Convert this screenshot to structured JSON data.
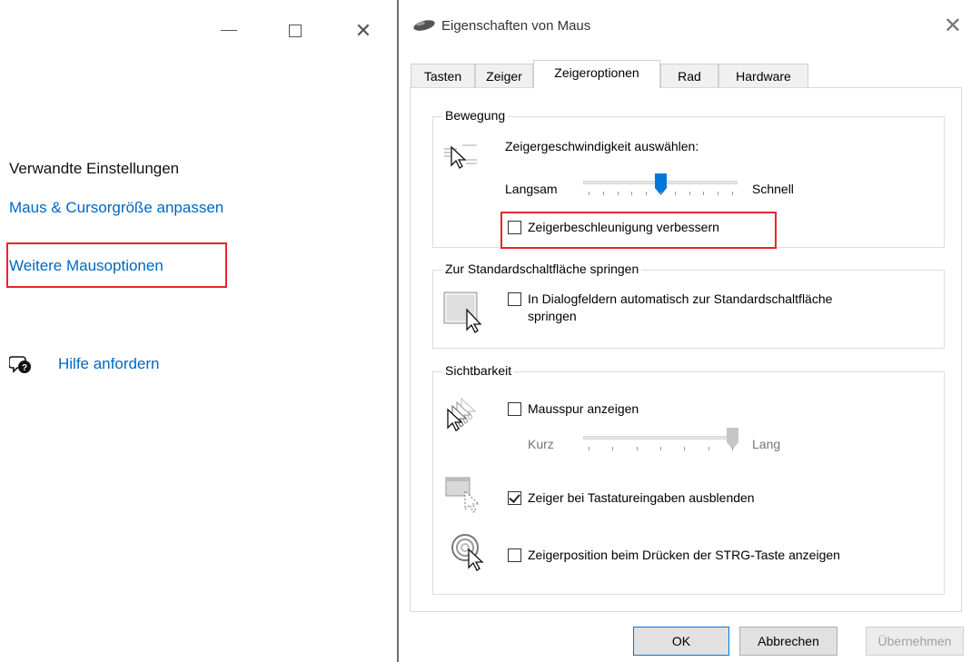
{
  "settings": {
    "related_title": "Verwandte Einstellungen",
    "link_cursor": "Maus & Cursorgröße anpassen",
    "link_more": "Weitere Mausoptionen",
    "help": "Hilfe anfordern",
    "window_controls": [
      "minimize-icon",
      "maximize-icon",
      "close-icon"
    ]
  },
  "dialog": {
    "title": "Eigenschaften von Maus",
    "tabs": [
      "Tasten",
      "Zeiger",
      "Zeigeroptionen",
      "Rad",
      "Hardware"
    ],
    "active_tab": "Zeigeroptionen",
    "motion": {
      "label": "Bewegung",
      "speed_label": "Zeigergeschwindigkeit auswählen:",
      "slow": "Langsam",
      "fast": "Schnell",
      "speed_value": 0.5,
      "precision_label": "Zeigerbeschleunigung verbessern",
      "precision_checked": false
    },
    "snap": {
      "label": "Zur Standardschaltfläche springen",
      "option_label_line1": "In Dialogfeldern automatisch zur Standardschaltfläche",
      "option_label_line2": "springen",
      "checked": false
    },
    "visibility": {
      "label": "Sichtbarkeit",
      "trail_label": "Mausspur anzeigen",
      "trail_checked": false,
      "short": "Kurz",
      "long": "Lang",
      "trail_value": 1.0,
      "hide_label": "Zeiger bei Tastatureingaben ausblenden",
      "hide_checked": true,
      "ctrl_label": "Zeigerposition beim Drücken der STRG-Taste anzeigen",
      "ctrl_checked": false
    },
    "buttons": {
      "ok": "OK",
      "cancel": "Abbrechen",
      "apply": "Übernehmen"
    }
  },
  "colors": {
    "link": "#0067c0",
    "highlight": "#e8242b",
    "slider_thumb": "#0078d7"
  }
}
